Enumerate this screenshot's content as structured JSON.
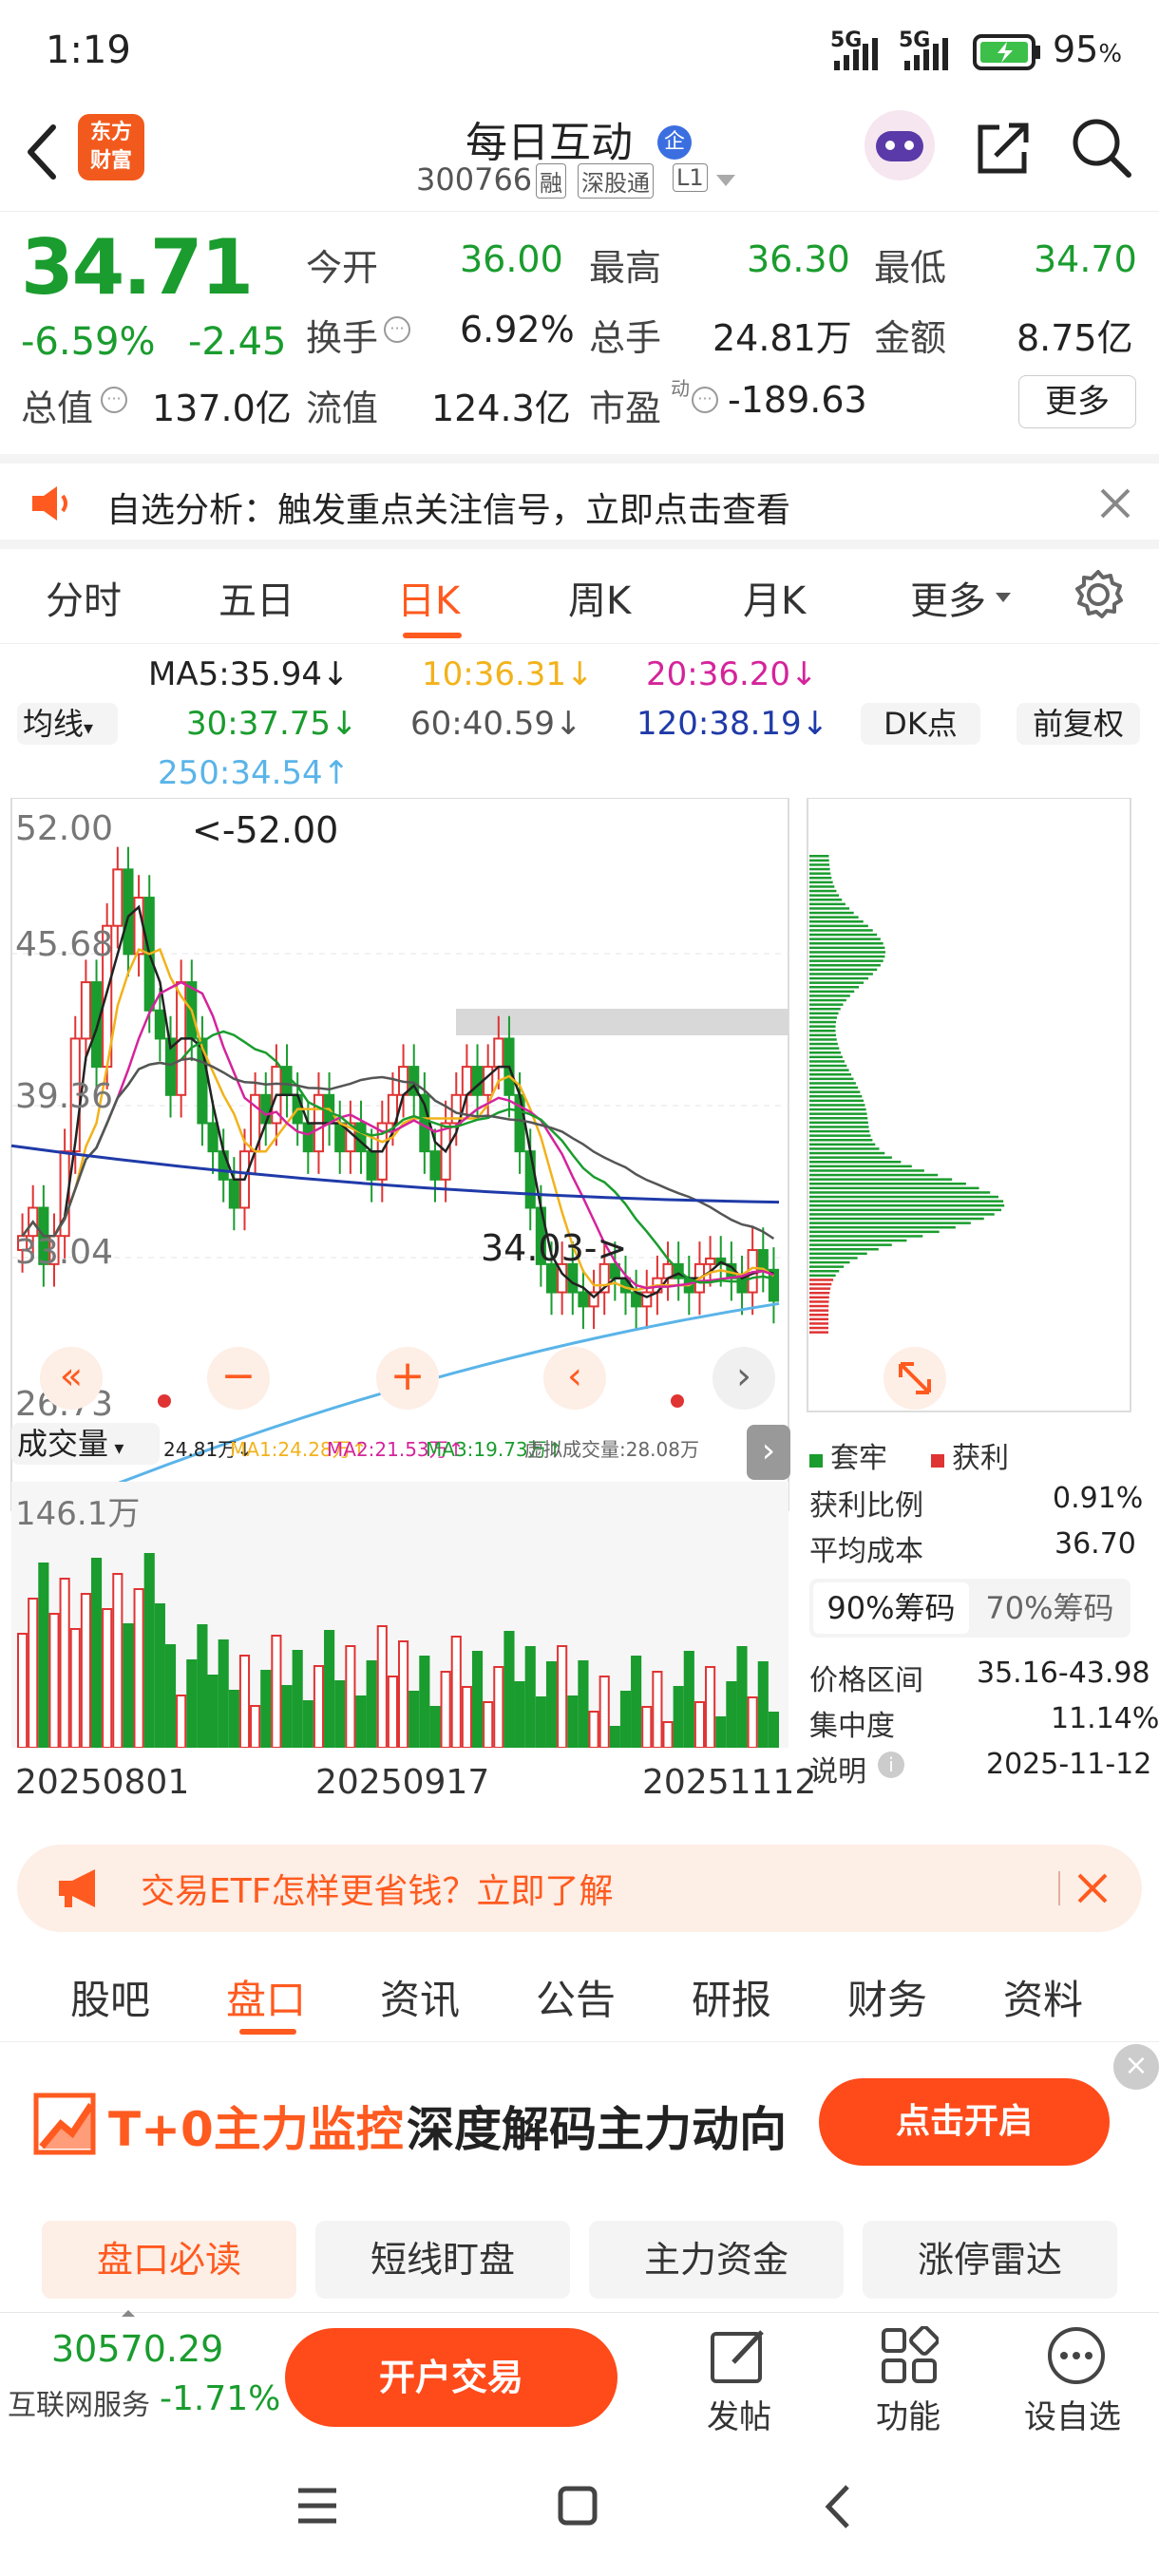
{
  "status": {
    "time": "1:19",
    "signal1": "5G",
    "signal2": "5G",
    "battery": "95"
  },
  "header": {
    "logo_line1": "东方",
    "logo_line2": "财富",
    "title": "每日互动",
    "title_badge": "企",
    "code": "300766",
    "tag1": "融",
    "tag2": "深股通",
    "tag3": "L1"
  },
  "quote": {
    "price": "34.71",
    "pct": "-6.59%",
    "chg": "-2.45",
    "open_label": "今开",
    "open": "36.00",
    "high_label": "最高",
    "high": "36.30",
    "low_label": "最低",
    "low": "34.70",
    "turnover_label": "换手",
    "turnover": "6.92%",
    "volume_label": "总手",
    "volume": "24.81万",
    "amount_label": "金额",
    "amount": "8.75亿",
    "mktcap_label": "总值",
    "mktcap": "137.0亿",
    "float_label": "流值",
    "float": "124.3亿",
    "pe_label": "市盈",
    "pe_sup": "动",
    "pe": "-189.63",
    "more": "更多"
  },
  "notice": {
    "text": "自选分析：触发重点关注信号，立即点击查看"
  },
  "period_tabs": [
    "分时",
    "五日",
    "日K",
    "周K",
    "月K",
    "更多"
  ],
  "kline": {
    "indicator_select": "均线",
    "ma5": "MA5:35.94",
    "ma10": "10:36.31",
    "ma20": "20:36.20",
    "ma30": "30:37.75",
    "ma60": "60:40.59",
    "ma120": "120:38.19",
    "ma250": "250:34.54",
    "dk_button": "DK点",
    "adjust_button": "前复权",
    "y_labels": [
      "52.00",
      "45.68",
      "39.36",
      "33.04",
      "26.73"
    ],
    "max_annotation": "<-52.00",
    "min_annotation": "34.03->",
    "vol_select": "成交量",
    "vol_line": "24.81万",
    "vol_ma1": "MA1:24.28万",
    "vol_ma2": "MA2:21.53万",
    "vol_ma3": "MA3:19.73万",
    "vol_virtual": "虚拟成交量:28.08万",
    "vol_ylabel": "146.1万",
    "dates": [
      "20250801",
      "20250917",
      "20251112"
    ]
  },
  "chip": {
    "legend_trap": "套牢",
    "legend_profit": "获利",
    "rows": [
      {
        "label": "获利比例",
        "value": "0.91%"
      },
      {
        "label": "平均成本",
        "value": "36.70"
      }
    ],
    "tab_90": "90%筹码",
    "tab_70": "70%筹码",
    "rows2": [
      {
        "label": "价格区间",
        "value": "35.16-43.98"
      },
      {
        "label": "集中度",
        "value": "11.14%"
      },
      {
        "label": "说明",
        "value": "2025-11-12"
      }
    ]
  },
  "ad2": {
    "text": "交易ETF怎样更省钱？立即了解"
  },
  "bottom_tabs": [
    "股吧",
    "盘口",
    "资讯",
    "公告",
    "研报",
    "财务",
    "资料"
  ],
  "banner": {
    "title_a": "T+0主力监控",
    "title_b": "深度解码主力动向",
    "button": "点击开启"
  },
  "sub_tabs": [
    "盘口必读",
    "短线盯盘",
    "主力资金",
    "涨停雷达"
  ],
  "bottombar": {
    "index_value": "30570.29",
    "index_name": "互联网服务",
    "index_pct": "-1.71%",
    "trade_button": "开户交易",
    "post": "发帖",
    "func": "功能",
    "watch": "设自选"
  },
  "colors": {
    "up": "#e03333",
    "down": "#1a9c2e",
    "accent": "#ff5a1f",
    "ma5": "#222222",
    "ma10": "#f2b21b",
    "ma20": "#d4249b",
    "ma30": "#1a9c2e",
    "ma60": "#555555",
    "ma120": "#1f3aa8",
    "ma250": "#5ab4e8"
  }
}
